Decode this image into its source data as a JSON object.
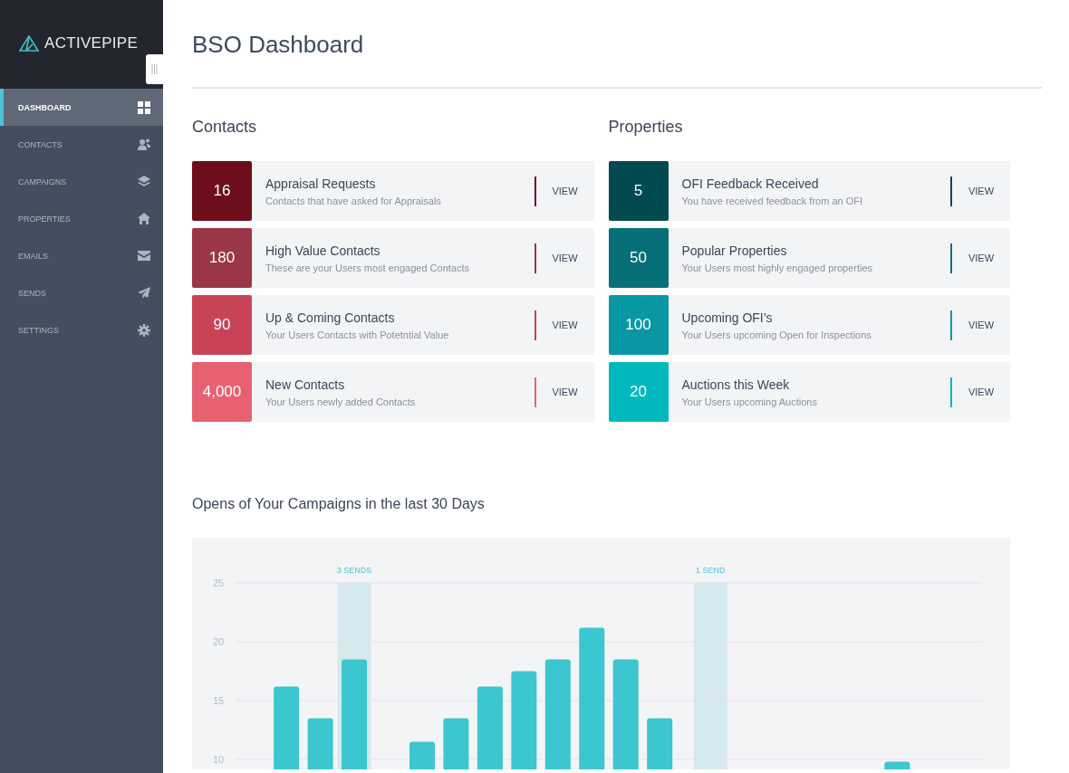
{
  "sidebar": {
    "logo": "ACTIVEPIPE",
    "items": [
      {
        "label": "DASHBOARD",
        "selected": true
      },
      {
        "label": "CONTACTS",
        "selected": false
      },
      {
        "label": "CAMPAIGNS",
        "selected": false
      },
      {
        "label": "PROPERTIES",
        "selected": false
      },
      {
        "label": "EMAILS",
        "selected": false
      },
      {
        "label": "SENDS",
        "selected": false
      },
      {
        "label": "SETTINGS",
        "selected": false
      }
    ]
  },
  "page": {
    "title": "BSO Dashboard"
  },
  "sections": [
    {
      "heading": "Contacts",
      "cards": [
        {
          "count": "16",
          "title": "Appraisal Requests",
          "subtitle": "Contacts that have asked for Appraisals",
          "action": "VIEW",
          "color": "#6e0e1c"
        },
        {
          "count": "180",
          "title": "High Value Contacts",
          "subtitle": "These are your Users most engaged Contacts",
          "action": "VIEW",
          "color": "#9a3645"
        },
        {
          "count": "90",
          "title": "Up & Coming Contacts",
          "subtitle": "Your Users Contacts with Potetntial Value",
          "action": "VIEW",
          "color": "#c94357"
        },
        {
          "count": "4,000",
          "title": "New Contacts",
          "subtitle": "Your Users newly added Contacts",
          "action": "VIEW",
          "color": "#e66272"
        }
      ]
    },
    {
      "heading": "Properties",
      "cards": [
        {
          "count": "5",
          "title": "OFI Feedback Received",
          "subtitle": "You have received feedback from an OFI",
          "action": "VIEW",
          "color": "#024950"
        },
        {
          "count": "50",
          "title": "Popular Properties",
          "subtitle": "Your Users most highly engaged properties",
          "action": "VIEW",
          "color": "#066f77"
        },
        {
          "count": "100",
          "title": "Upcoming OFI’s",
          "subtitle": "Your Users upcoming Open for Inspections",
          "action": "VIEW",
          "color": "#0898a3"
        },
        {
          "count": "20",
          "title": "Auctions this Week",
          "subtitle": "Your Users upcoming Auctions",
          "action": "VIEW",
          "color": "#00b8bd"
        }
      ]
    }
  ],
  "chart": {
    "title": "Opens of Your Campaigns in the last 30 Days",
    "highlights": [
      {
        "label": "3 SENDS"
      },
      {
        "label": "1 SEND"
      }
    ],
    "chart_data": {
      "type": "bar",
      "grid": true,
      "series": [
        {
          "color": "#3cc6cf",
          "values": [
            null,
            16.2,
            13.5,
            18.5,
            null,
            11.5,
            13.5,
            16.2,
            17.5,
            18.5,
            21.2,
            18.5,
            13.5,
            null,
            null,
            null,
            null,
            null,
            null,
            9.8,
            null,
            null
          ]
        }
      ],
      "ylim": [
        0,
        25
      ],
      "yticks": [
        10,
        15,
        20,
        25
      ]
    }
  }
}
